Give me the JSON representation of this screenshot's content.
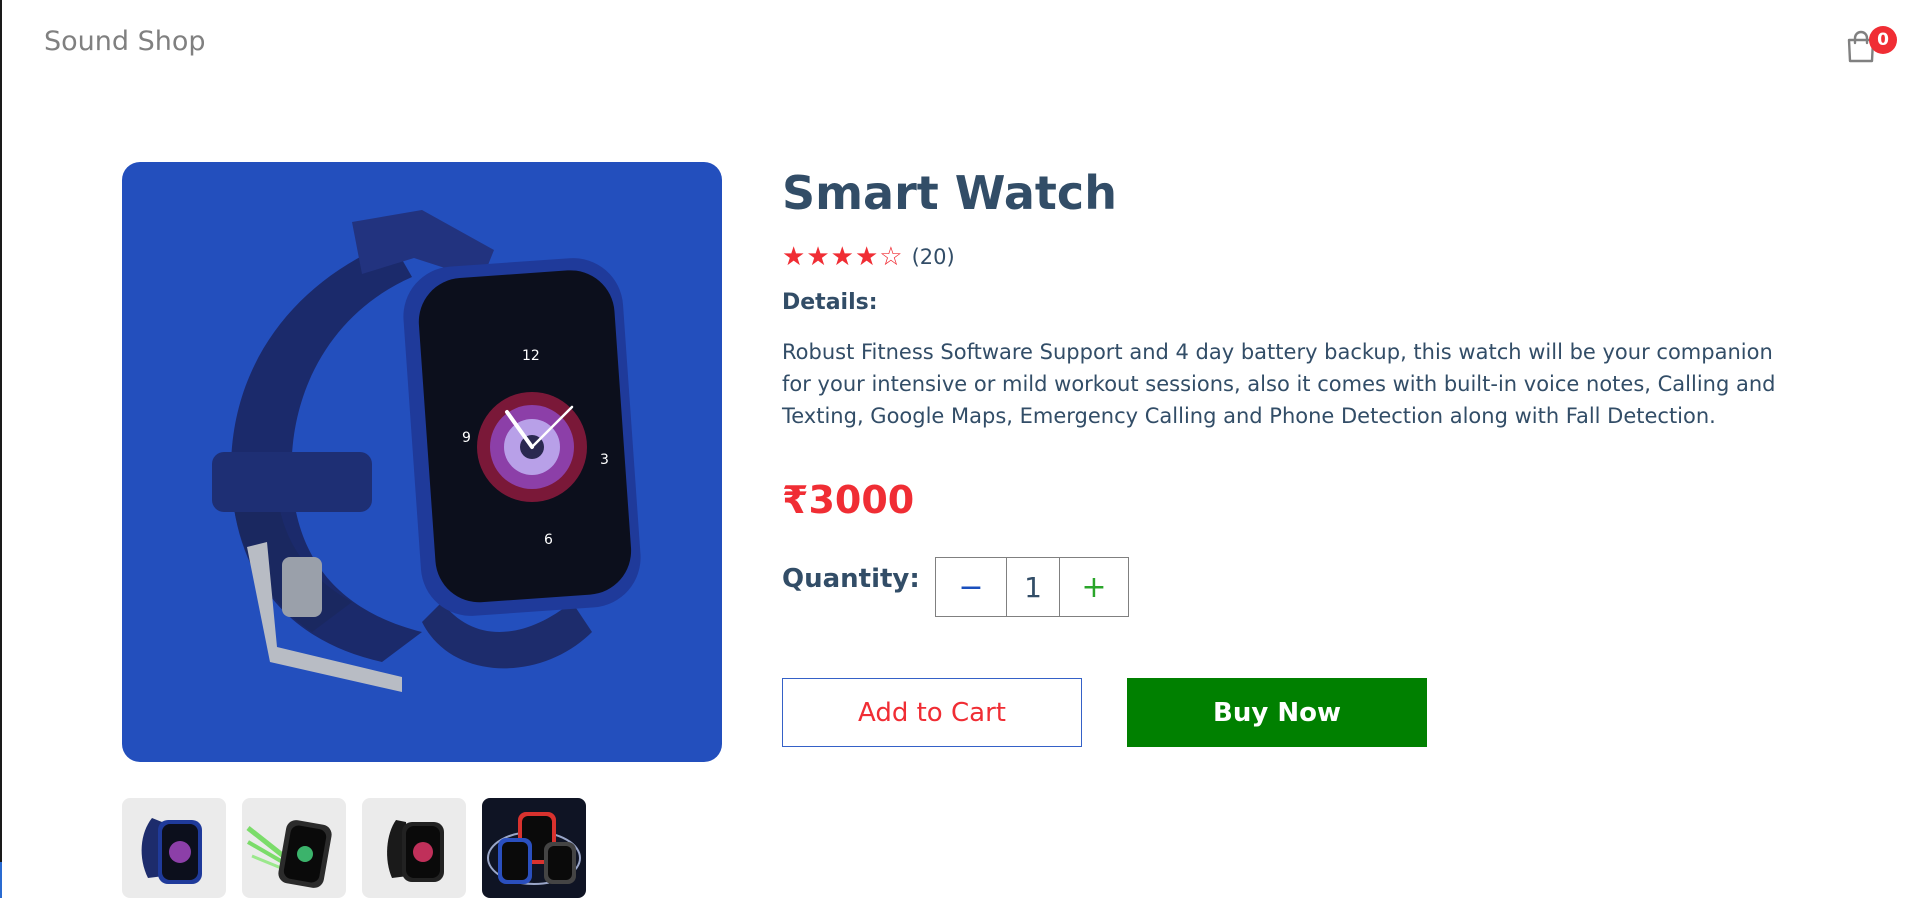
{
  "navbar": {
    "logo": "Sound Shop",
    "cart_icon": "shopping-bag-icon",
    "cart_count": "0"
  },
  "product": {
    "name": "Smart Watch",
    "rating": {
      "stars_filled": 4,
      "stars_total": 5,
      "review_count": "(20)"
    },
    "details_label": "Details:",
    "description": "Robust Fitness Software Support and 4 day battery backup, this watch will be your companion for your intensive or mild workout sessions, also it comes with built-in voice notes, Calling and Texting, Google Maps, Emergency Calling and Phone Detection along with Fall Detection.",
    "price": "₹3000",
    "quantity_label": "Quantity:",
    "quantity": {
      "minus": "−",
      "value": "1",
      "plus": "+"
    },
    "add_to_cart_label": "Add to Cart",
    "buy_now_label": "Buy Now",
    "thumbnails": 4
  },
  "colors": {
    "brand_red": "#f02d34",
    "text_dark": "#324d67",
    "image_bg": "#234fbd",
    "buy_green": "#008000",
    "thumb_bg": "#ebebeb"
  }
}
